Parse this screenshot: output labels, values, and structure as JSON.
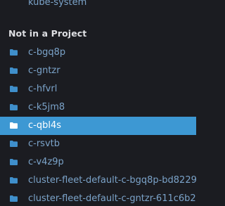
{
  "top_item": {
    "label": "kube-system"
  },
  "section": {
    "title": "Not in a Project"
  },
  "namespaces": [
    {
      "label": "c-bgq8p",
      "selected": false
    },
    {
      "label": "c-gntzr",
      "selected": false
    },
    {
      "label": "c-hfvrl",
      "selected": false
    },
    {
      "label": "c-k5jm8",
      "selected": false
    },
    {
      "label": "c-qbl4s",
      "selected": true
    },
    {
      "label": "c-rsvtb",
      "selected": false
    },
    {
      "label": "c-v4z9p",
      "selected": false
    },
    {
      "label": "cluster-fleet-default-c-bgq8p-bd8229",
      "selected": false
    },
    {
      "label": "cluster-fleet-default-c-gntzr-611c6b2",
      "selected": false
    }
  ],
  "colors": {
    "background": "#1b1c21",
    "link": "#7ba3c9",
    "header": "#dedfe3",
    "selected_bg": "#3d98d3",
    "selected_text": "#ffffff",
    "folder_icon": "#3f8fcb"
  },
  "icons": {
    "namespace": "folder-icon"
  }
}
